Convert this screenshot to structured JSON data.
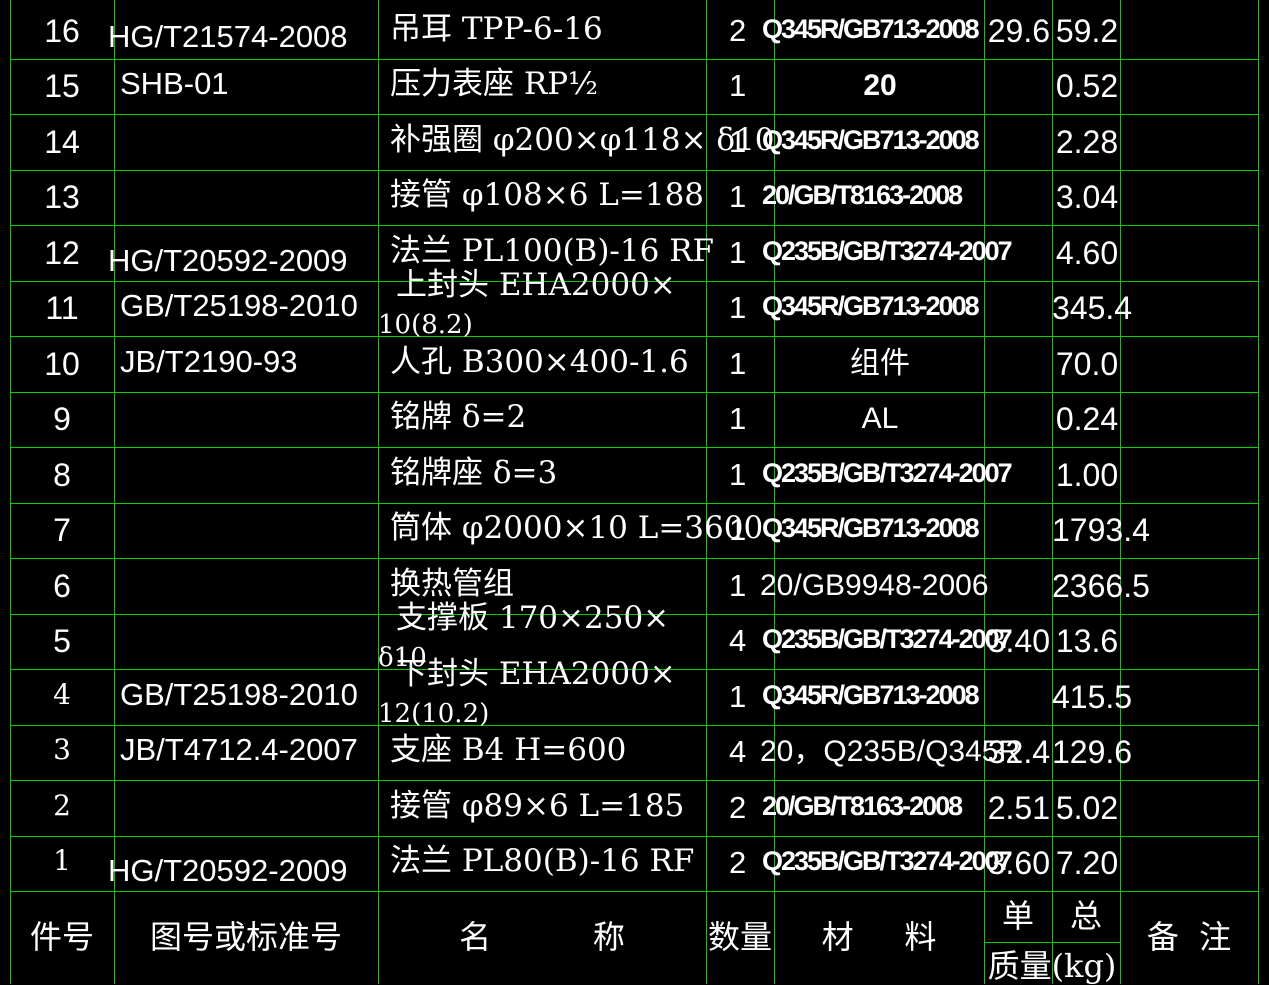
{
  "rows": [
    {
      "no": "16",
      "std": "HG/T21574-2008",
      "name": "吊耳  TPP-6-16",
      "qty": "2",
      "mat": "Q345R/GB713-2008",
      "unit": "29.6",
      "total": "59.2"
    },
    {
      "no": "15",
      "std": "SHB-01",
      "name": "压力表座  RP½",
      "qty": "1",
      "mat": "20",
      "unit": "",
      "total": "0.52"
    },
    {
      "no": "14",
      "std": "",
      "name": "补强圈 φ200×φ118× δ10",
      "qty": "1",
      "mat": "Q345R/GB713-2008",
      "unit": "",
      "total": "2.28"
    },
    {
      "no": "13",
      "std": "",
      "name": "接管 φ108×6   L=188",
      "qty": "1",
      "mat": "20/GB/T8163-2008",
      "unit": "",
      "total": "3.04"
    },
    {
      "no": "12",
      "std": "HG/T20592-2009",
      "name": "法兰  PL100(B)-16 RF",
      "qty": "1",
      "mat": "Q235B/GB/T3274-2007",
      "unit": "",
      "total": "4.60"
    },
    {
      "no": "11",
      "std": "GB/T25198-2010",
      "name": "上封头  EHA2000×",
      "name2": "10(8.2)",
      "qty": "1",
      "mat": "Q345R/GB713-2008",
      "unit": "",
      "total": "345.4"
    },
    {
      "no": "10",
      "std": "JB/T2190-93",
      "name": "人孔  B300×400-1.6",
      "qty": "1",
      "mat": "组件",
      "unit": "",
      "total": "70.0"
    },
    {
      "no": "9",
      "std": "",
      "name": "铭牌     δ=2",
      "qty": "1",
      "mat": "AL",
      "unit": "",
      "total": "0.24"
    },
    {
      "no": "8",
      "std": "",
      "name": "铭牌座     δ=3",
      "qty": "1",
      "mat": "Q235B/GB/T3274-2007",
      "unit": "",
      "total": "1.00"
    },
    {
      "no": "7",
      "std": "",
      "name": "筒体 φ2000×10   L=3600",
      "qty": "1",
      "mat": "Q345R/GB713-2008",
      "unit": "",
      "total": "1793.4"
    },
    {
      "no": "6",
      "std": "",
      "name": "换热管组",
      "qty": "1",
      "mat": "20/GB9948-2006",
      "unit": "",
      "total": "2366.5"
    },
    {
      "no": "5",
      "std": "",
      "name": "支撑板  170×250×",
      "name2": "δ10",
      "qty": "4",
      "mat": "Q235B/GB/T3274-2007",
      "unit": "3.40",
      "total": "13.6"
    },
    {
      "no": "4",
      "std": "GB/T25198-2010",
      "name": "下封头  EHA2000×",
      "name2": "12(10.2)",
      "qty": "1",
      "mat": "Q345R/GB713-2008",
      "unit": "",
      "total": "415.5"
    },
    {
      "no": "3",
      "std": "JB/T4712.4-2007",
      "name": "支座  B4 H=600",
      "qty": "4",
      "mat": "20，Q235B/Q345R",
      "unit": "32.4",
      "total": "129.6"
    },
    {
      "no": "2",
      "std": "",
      "name": "接管 φ89×6   L=185",
      "qty": "2",
      "mat": "20/GB/T8163-2008",
      "unit": "2.51",
      "total": "5.02"
    },
    {
      "no": "1",
      "std": "HG/T20592-2009",
      "name": "法兰  PL80(B)-16 RF",
      "qty": "2",
      "mat": "Q235B/GB/T3274-2007",
      "unit": "3.60",
      "total": "7.20"
    }
  ],
  "header": {
    "no": "件号",
    "std": "图号或标准号",
    "name": "名          称",
    "qty": "数量",
    "mat": "材     料",
    "unit": "单",
    "total": "总",
    "mass": "质量(kg)",
    "remark": "备  注"
  },
  "colors": {
    "grid": "#00d200",
    "text": "#ffffff",
    "background": "#000000"
  }
}
